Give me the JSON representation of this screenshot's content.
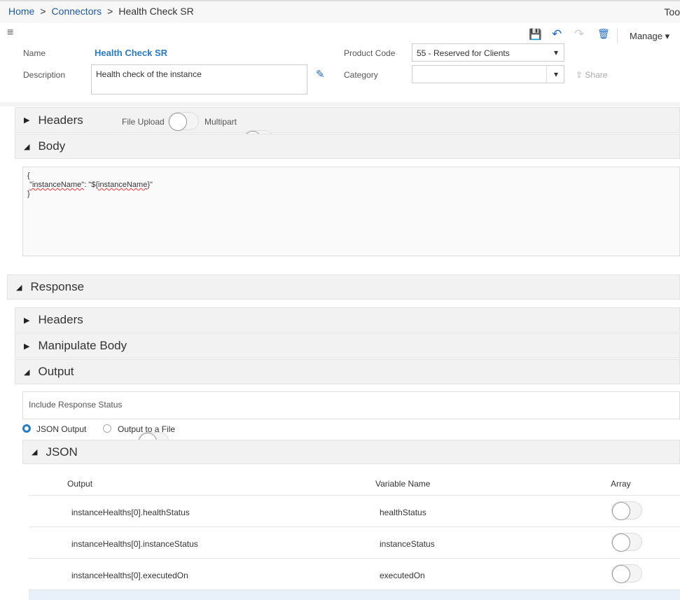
{
  "breadcrumb": {
    "home": "Home",
    "connectors": "Connectors",
    "current": "Health Check SR",
    "right_text": "Too"
  },
  "toolbar": {
    "manage": "Manage",
    "share": "Share"
  },
  "form": {
    "name_label": "Name",
    "name_value": "Health Check SR",
    "description_label": "Description",
    "description_value": "Health check of the instance",
    "product_code_label": "Product Code",
    "product_code_value": "55 - Reserved for Clients",
    "category_label": "Category",
    "category_value": ""
  },
  "request": {
    "headers": "Headers",
    "file_upload": "File Upload",
    "multipart": "Multipart",
    "body": "Body",
    "body_lines": [
      "{",
      "\"instanceName\"",
      ": \"${",
      "instanceName",
      "}\"",
      "}"
    ]
  },
  "response": {
    "title": "Response",
    "headers": "Headers",
    "manipulate_body": "Manipulate Body",
    "output": "Output",
    "include_status": "Include Response Status",
    "json_output": "JSON Output",
    "output_file": "Output to a File",
    "json": "JSON",
    "columns": [
      "Output",
      "Variable Name",
      "Array"
    ],
    "rows": [
      {
        "output": "instanceHealths[0].healthStatus",
        "variable": "healthStatus"
      },
      {
        "output": "instanceHealths[0].instanceStatus",
        "variable": "instanceStatus"
      },
      {
        "output": "instanceHealths[0].executedOn",
        "variable": "executedOn"
      }
    ]
  },
  "colors": {
    "link": "#1e5aa0",
    "accent": "#2a7ac0"
  }
}
